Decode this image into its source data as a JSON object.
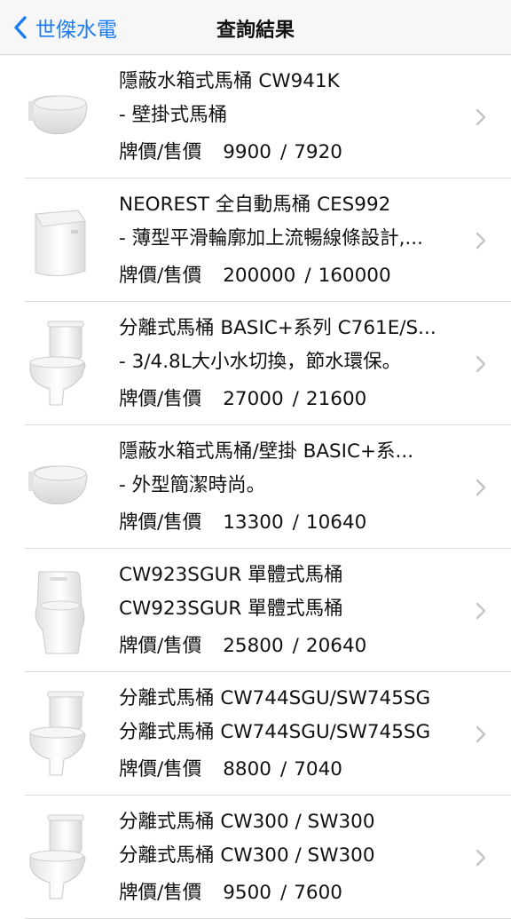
{
  "nav": {
    "back_label": "世傑水電",
    "title": "查詢結果"
  },
  "price_label": "牌價/售價",
  "items": [
    {
      "name": "隱蔽水箱式馬桶 CW941K",
      "desc": "- 壁掛式馬桶",
      "list_price": "9900",
      "sale_price": "7920",
      "image": "wall-hung-toilet"
    },
    {
      "name": "NEOREST 全自動馬桶 CES992",
      "desc": "- 薄型平滑輪廓加上流暢線條設計,...",
      "list_price": "200000",
      "sale_price": "160000",
      "image": "smart-toilet"
    },
    {
      "name": "分離式馬桶 BASIC+系列 C761E/S...",
      "desc": "- 3/4.8L大小水切換，節水環保。",
      "list_price": "27000",
      "sale_price": "21600",
      "image": "two-piece-toilet"
    },
    {
      "name": "隱蔽水箱式馬桶/壁掛 BASIC+系...",
      "desc": "- 外型簡潔時尚。",
      "list_price": "13300",
      "sale_price": "10640",
      "image": "wall-hung-toilet"
    },
    {
      "name": "CW923SGUR 單體式馬桶",
      "desc": "CW923SGUR 單體式馬桶",
      "list_price": "25800",
      "sale_price": "20640",
      "image": "one-piece-toilet"
    },
    {
      "name": "分離式馬桶 CW744SGU/SW745SG",
      "desc": "分離式馬桶 CW744SGU/SW745SG",
      "list_price": "8800",
      "sale_price": "7040",
      "image": "two-piece-toilet"
    },
    {
      "name": "分離式馬桶 CW300 / SW300",
      "desc": "分離式馬桶 CW300 / SW300",
      "list_price": "9500",
      "sale_price": "7600",
      "image": "two-piece-toilet"
    }
  ],
  "colors": {
    "accent": "#1a7cf5",
    "separator": "#dcdcdf",
    "chevron": "#c4c4c8"
  }
}
